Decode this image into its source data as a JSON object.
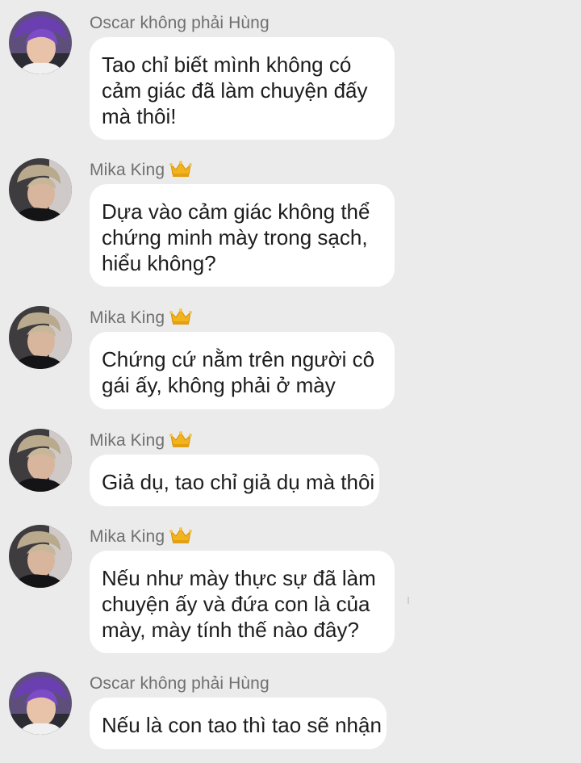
{
  "messages": [
    {
      "sender": "Oscar không phải Hùng",
      "avatar": "purple-hair-avatar",
      "crown": false,
      "lines": [
        "Tao chỉ biết mình không có",
        "cảm giác đã làm chuyện đấy",
        "mà thôi!"
      ]
    },
    {
      "sender": "Mika King",
      "avatar": "blond-hair-avatar",
      "crown": true,
      "lines": [
        "Dựa vào cảm giác không thể",
        "chứng minh mày trong sạch,",
        "hiểu không?"
      ]
    },
    {
      "sender": "Mika King",
      "avatar": "blond-hair-avatar",
      "crown": true,
      "lines": [
        "Chứng cứ nằm trên người cô",
        "gái ấy, không phải ở mày"
      ]
    },
    {
      "sender": "Mika King",
      "avatar": "blond-hair-avatar",
      "crown": true,
      "lines": [
        "Giả dụ, tao chỉ giả dụ mà thôi"
      ]
    },
    {
      "sender": "Mika King",
      "avatar": "blond-hair-avatar",
      "crown": true,
      "lines": [
        "Nếu như mày thực sự đã làm",
        "chuyện ấy và đứa con là của",
        "mày, mày tính thế nào đây?"
      ]
    },
    {
      "sender": "Oscar không phải Hùng",
      "avatar": "purple-hair-avatar",
      "crown": false,
      "lines": [
        "Nếu là con tao thì tao sẽ nhận"
      ]
    }
  ],
  "colors": {
    "background": "#ebebeb",
    "bubble": "#ffffff",
    "sender_text": "#707070",
    "message_text": "#1d1d1d",
    "crown": "#f2b31b"
  }
}
